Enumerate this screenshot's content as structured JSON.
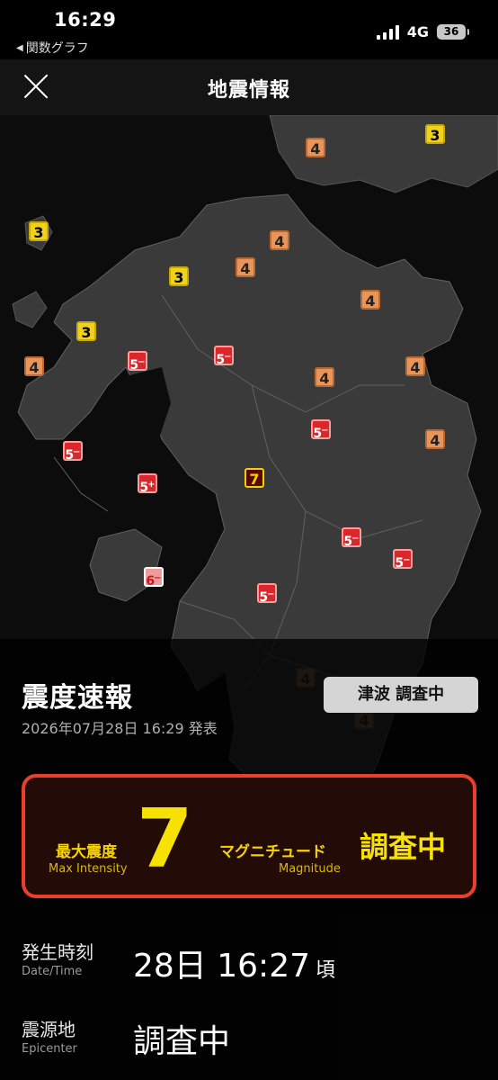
{
  "status_bar": {
    "time": "16:29",
    "back_app": "関数グラフ",
    "network": "4G",
    "battery": "36"
  },
  "header": {
    "title": "地震情報"
  },
  "map": {
    "colors": {
      "s3": "#f0d21a",
      "s4": "#e9955a",
      "s5": "#d9272c",
      "s6": "#f09a9c",
      "s7": "#5a0708"
    }
  },
  "panel": {
    "heading": "震度速報",
    "published": "2026年07月28日 16:29 発表",
    "tsunami_badge": "津波 調査中",
    "summary": {
      "max_intensity_label": "最大震度",
      "max_intensity_label_en": "Max Intensity",
      "max_intensity_value": "7",
      "magnitude_label": "マグニチュード",
      "magnitude_label_en": "Magnitude",
      "magnitude_value": "調査中"
    },
    "occurrence": {
      "label": "発生時刻",
      "label_en": "Date/Time",
      "value": "28日 16:27",
      "suffix": "頃"
    },
    "epicenter": {
      "label": "震源地",
      "label_en": "Epicenter",
      "value": "調査中"
    }
  }
}
